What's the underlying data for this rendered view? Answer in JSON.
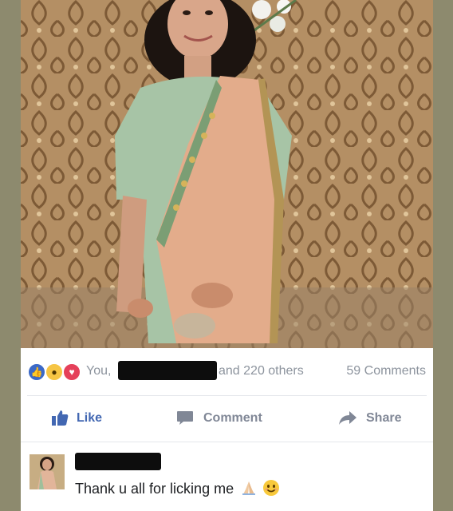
{
  "post": {
    "photo": {
      "description_icon": "photo-of-woman-in-saree"
    },
    "reactions": {
      "icons": [
        "like-icon",
        "wow-icon",
        "love-icon"
      ],
      "you_label": "You,",
      "others_label": "and 220 others",
      "comments_count": "59 Comments"
    },
    "actions": {
      "like_label": "Like",
      "comment_label": "Comment",
      "share_label": "Share"
    },
    "comment": {
      "text": "Thank u all for licking me",
      "emojis": [
        "folded-hands-icon",
        "smiling-face-icon"
      ]
    }
  },
  "colors": {
    "background": "#8d8a6e",
    "facebook_blue": "#4267b2",
    "muted_text": "#8d949e",
    "love_red": "#e5405a",
    "wow_yellow": "#f6c544"
  }
}
